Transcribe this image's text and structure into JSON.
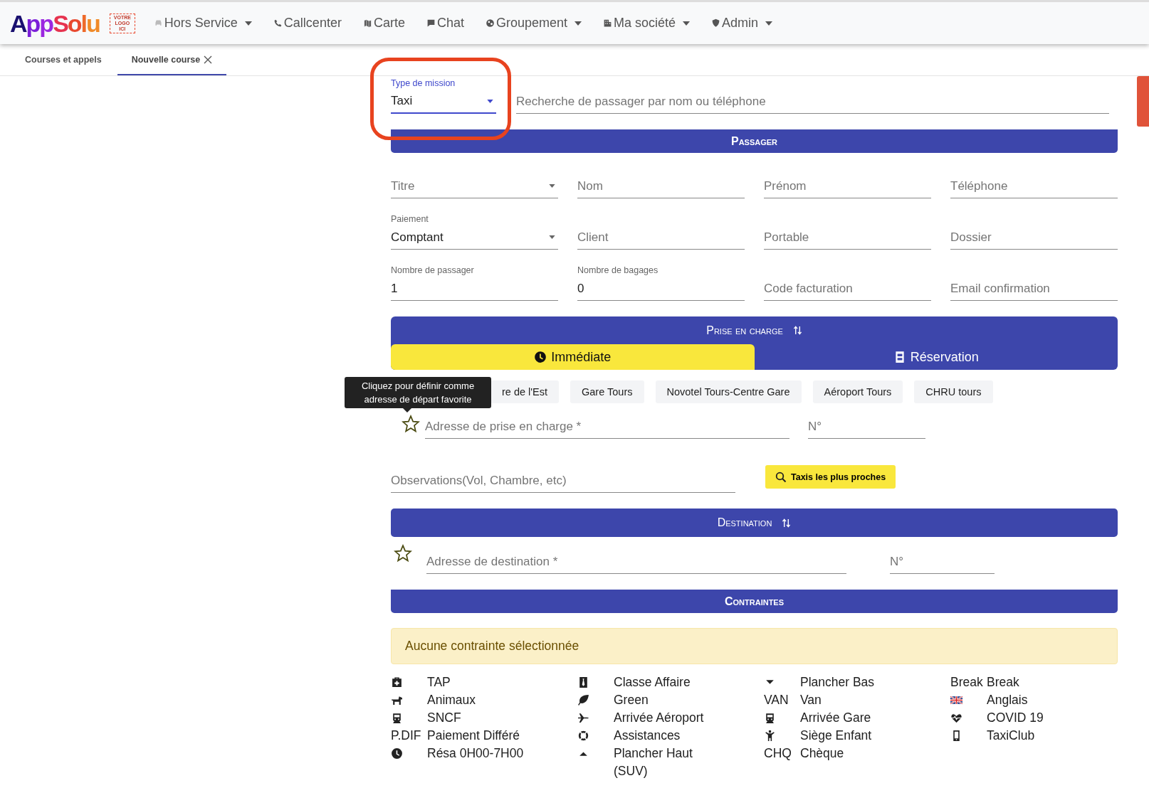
{
  "navbar": {
    "logo": "AppSolu",
    "logo_placeholder": "VOTRE LOGO ICI",
    "items": [
      {
        "label": "Hors Service",
        "dropdown": true,
        "disabled": true
      },
      {
        "label": "Callcenter",
        "dropdown": false,
        "disabled": false
      },
      {
        "label": "Carte",
        "dropdown": false,
        "disabled": false
      },
      {
        "label": "Chat",
        "dropdown": false,
        "disabled": false
      },
      {
        "label": "Groupement",
        "dropdown": true,
        "disabled": false
      },
      {
        "label": "Ma société",
        "dropdown": true,
        "disabled": false
      },
      {
        "label": "Admin",
        "dropdown": true,
        "disabled": false
      }
    ]
  },
  "tabs": [
    {
      "label": "Courses et appels",
      "selected": false,
      "closable": false
    },
    {
      "label": "Nouvelle course",
      "selected": true,
      "closable": true
    }
  ],
  "mission": {
    "label": "Type de mission",
    "value": "Taxi"
  },
  "passenger_search": {
    "placeholder": "Recherche de passager par nom ou téléphone"
  },
  "passager": {
    "title": "Passager",
    "fields": [
      {
        "kind": "select",
        "placeholder": "Titre"
      },
      {
        "kind": "text",
        "placeholder": "Nom"
      },
      {
        "kind": "text",
        "placeholder": "Prénom"
      },
      {
        "kind": "text",
        "placeholder": "Téléphone"
      },
      {
        "kind": "select",
        "label": "Paiement",
        "value": "Comptant"
      },
      {
        "kind": "text",
        "placeholder": "Client"
      },
      {
        "kind": "text",
        "placeholder": "Portable"
      },
      {
        "kind": "text",
        "placeholder": "Dossier"
      },
      {
        "kind": "text",
        "label": "Nombre de passager",
        "value": "1"
      },
      {
        "kind": "text",
        "label": "Nombre de bagages",
        "value": "0"
      },
      {
        "kind": "text",
        "placeholder": "Code facturation"
      },
      {
        "kind": "text",
        "placeholder": "Email confirmation"
      }
    ]
  },
  "prise_en_charge": {
    "title": "Prise en charge",
    "modes": [
      {
        "label": "Immédiate",
        "selected": true
      },
      {
        "label": "Réservation",
        "selected": false
      }
    ],
    "favorites": [
      "re de l'Est",
      "Gare Tours",
      "Novotel Tours-Centre Gare",
      "Aéroport Tours",
      "CHRU tours"
    ],
    "tooltip": "Cliquez pour définir comme adresse de départ favorite",
    "address": {
      "placeholder": "Adresse de prise en charge *"
    },
    "number": {
      "placeholder": "N°"
    },
    "observations": {
      "placeholder": "Observations(Vol, Chambre, etc)"
    },
    "nearest_button": "Taxis les plus proches"
  },
  "destination": {
    "title": "Destination",
    "address": {
      "placeholder": "Adresse de destination *"
    },
    "number": {
      "placeholder": "N°"
    }
  },
  "contraintes": {
    "title": "Contraintes",
    "alert": "Aucune contrainte sélectionnée",
    "columns": [
      [
        {
          "kind": "icon",
          "label": "TAP"
        },
        {
          "kind": "icon",
          "label": "Animaux"
        },
        {
          "kind": "icon",
          "label": "SNCF"
        },
        {
          "kind": "code",
          "code": "P.DIF",
          "label": "Paiement Différé"
        },
        {
          "kind": "icon",
          "label": "Résa 0H00-7H00"
        }
      ],
      [
        {
          "kind": "icon",
          "label": "Classe Affaire"
        },
        {
          "kind": "icon",
          "label": "Green"
        },
        {
          "kind": "icon",
          "label": "Arrivée Aéroport"
        },
        {
          "kind": "icon",
          "label": "Assistances"
        },
        {
          "kind": "icon",
          "label": "Plancher Haut (SUV)"
        }
      ],
      [
        {
          "kind": "icon",
          "label": "Plancher Bas"
        },
        {
          "kind": "code",
          "code": "VAN",
          "label": "Van"
        },
        {
          "kind": "icon",
          "label": "Arrivée Gare"
        },
        {
          "kind": "icon",
          "label": "Siège Enfant"
        },
        {
          "kind": "code",
          "code": "CHQ",
          "label": "Chèque"
        }
      ],
      [
        {
          "kind": "code",
          "code": "Break",
          "label": "Break"
        },
        {
          "kind": "icon",
          "label": "Anglais"
        },
        {
          "kind": "icon",
          "label": "COVID 19"
        },
        {
          "kind": "icon",
          "label": "TaxiClub"
        }
      ]
    ]
  }
}
